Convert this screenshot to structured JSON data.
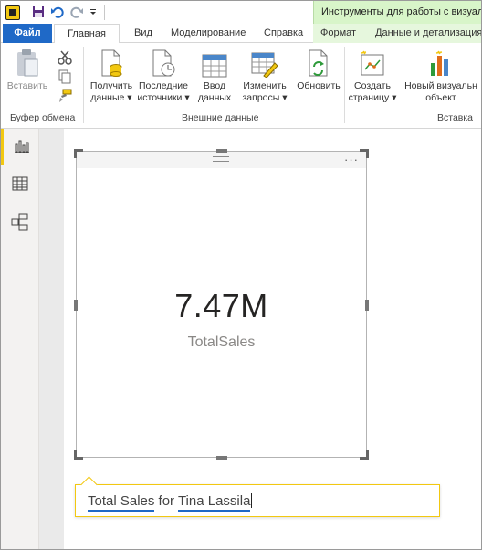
{
  "context_tab_label": "Инструменты для работы с визуаль",
  "tabs": [
    {
      "label": "Файл"
    },
    {
      "label": "Главная"
    },
    {
      "label": "Вид"
    },
    {
      "label": "Моделирование"
    },
    {
      "label": "Справка"
    },
    {
      "label": "Формат"
    },
    {
      "label": "Данные и детализация"
    }
  ],
  "ribbon": {
    "paste": "Вставить",
    "get_data_1": "Получить",
    "get_data_2": "данные",
    "recent_1": "Последние",
    "recent_2": "источники",
    "enter_1": "Ввод",
    "enter_2": "данных",
    "edit_1": "Изменить",
    "edit_2": "запросы",
    "refresh": "Обновить",
    "newpage_1": "Создать",
    "newpage_2": "страницу",
    "newvisual_1": "Новый визуальн",
    "newvisual_2": "объект",
    "group_clipboard": "Буфер обмена",
    "group_external": "Внешние данные",
    "group_insert": "Вставка"
  },
  "card": {
    "value": "7.47M",
    "label": "TotalSales",
    "more": "···"
  },
  "qa": {
    "part1": "Total Sales",
    "mid": " for ",
    "part2": "Tina Lassila"
  },
  "icons": [
    "app-icon",
    "save-icon",
    "undo-icon",
    "redo-icon",
    "qat-dropdown-icon",
    "paste-icon",
    "cut-icon",
    "copy-icon",
    "format-painter-icon",
    "get-data-icon",
    "recent-sources-icon",
    "enter-data-icon",
    "edit-queries-icon",
    "refresh-icon",
    "new-page-icon",
    "new-visual-icon",
    "report-view-icon",
    "data-view-icon",
    "model-view-icon"
  ],
  "colors": {
    "accent": "#f2c811",
    "file_tab": "#1f69c7",
    "context_band": "#d8f5c9"
  }
}
